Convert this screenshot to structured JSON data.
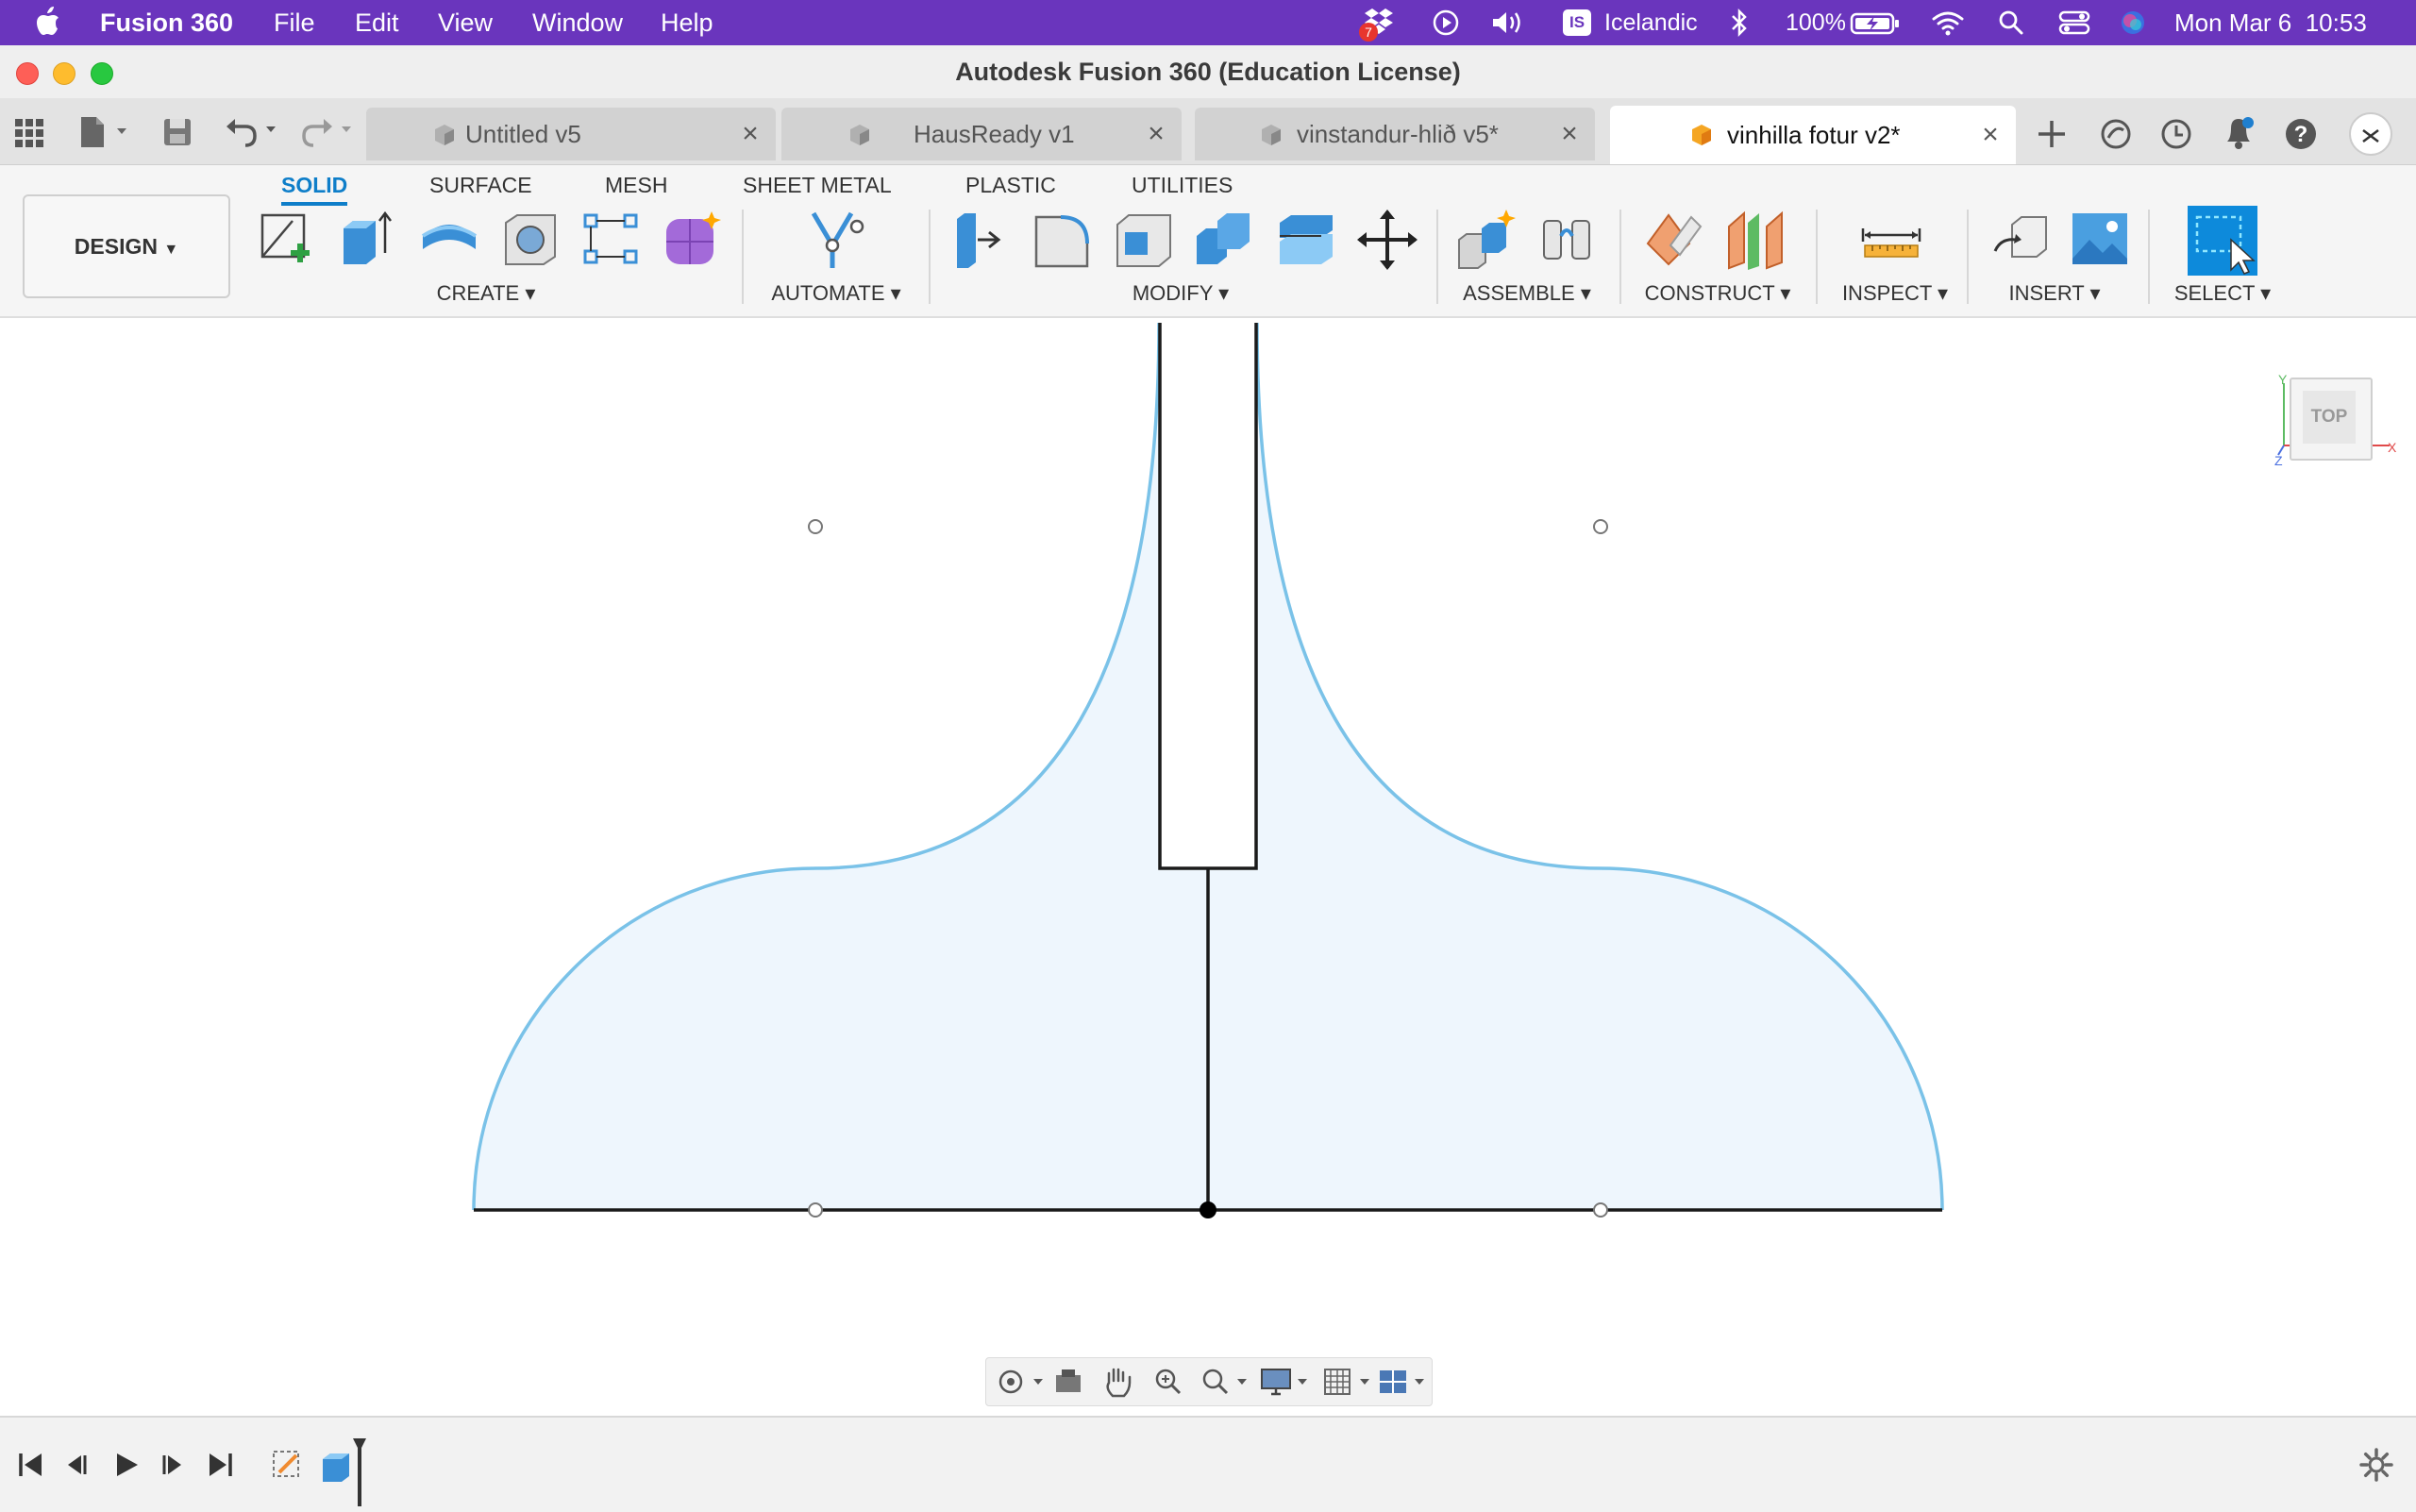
{
  "menubar": {
    "app_name": "Fusion 360",
    "menus": [
      "File",
      "Edit",
      "View",
      "Window",
      "Help"
    ],
    "dropbox_badge": "7",
    "input_source_badge": "IS",
    "input_source": "Icelandic",
    "battery": "100%",
    "datetime": "Mon Mar 6  10:53"
  },
  "window": {
    "title": "Autodesk Fusion 360 (Education License)"
  },
  "tabs": [
    {
      "label": "Untitled v5",
      "active": false
    },
    {
      "label": "HausReady v1",
      "active": false
    },
    {
      "label": "vinstandur-hlið v5*",
      "active": false
    },
    {
      "label": "vinhilla fotur v2*",
      "active": true
    }
  ],
  "ribbon": {
    "workspace": "DESIGN",
    "tabs": [
      "SOLID",
      "SURFACE",
      "MESH",
      "SHEET METAL",
      "PLASTIC",
      "UTILITIES"
    ],
    "active_tab": "SOLID",
    "groups": [
      "CREATE",
      "AUTOMATE",
      "MODIFY",
      "ASSEMBLE",
      "CONSTRUCT",
      "INSPECT",
      "INSERT",
      "SELECT"
    ]
  },
  "viewcube": {
    "face": "TOP",
    "axes": [
      "Y",
      "X",
      "Z"
    ]
  },
  "colors": {
    "menubar": "#6a35bd",
    "accent": "#0e7ec9",
    "profile_fill": "#eef6fd",
    "profile_edge": "#7ac2e8",
    "sketch_line": "#1a1a1a"
  }
}
